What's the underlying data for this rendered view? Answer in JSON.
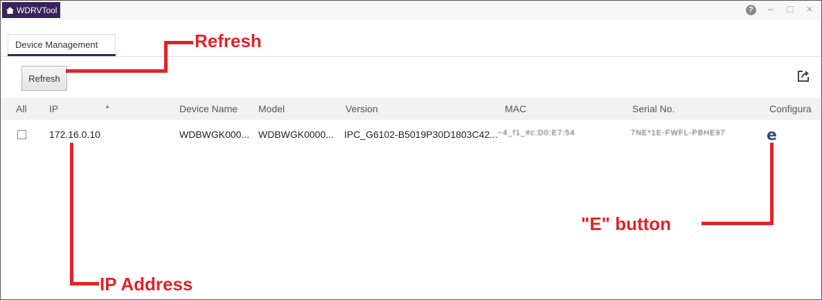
{
  "window": {
    "app_title": "WDRVTool",
    "controls": {
      "help": "?",
      "minimize": "–",
      "maximize": "□",
      "close": "×"
    }
  },
  "tabs": [
    {
      "label": "Device Management",
      "active": true
    }
  ],
  "toolbar": {
    "refresh_label": "Refresh",
    "export_icon": "export-icon"
  },
  "table": {
    "columns": [
      "All",
      "IP",
      "Device Name",
      "Model",
      "Version",
      "MAC",
      "Serial No.",
      "Configura"
    ],
    "rows": [
      {
        "checked": false,
        "ip": "172.16.0.10",
        "device_name": "WDBWGK000...",
        "model": "WDBWGK0000...",
        "version": "IPC_G6102-B5019P30D1803C42...",
        "mac": "~4_f1_#c:D0:E7:54",
        "serial": "7NE*1E-FWFL-PBHE97",
        "configure_icon": "ie-icon"
      }
    ]
  },
  "annotations": {
    "refresh": "Refresh",
    "ip_address": "IP Address",
    "e_button": "\"E\" button"
  },
  "colors": {
    "accent": "#3a235a",
    "annotation": "#e32229",
    "ie_icon": "#2e4c7e"
  }
}
